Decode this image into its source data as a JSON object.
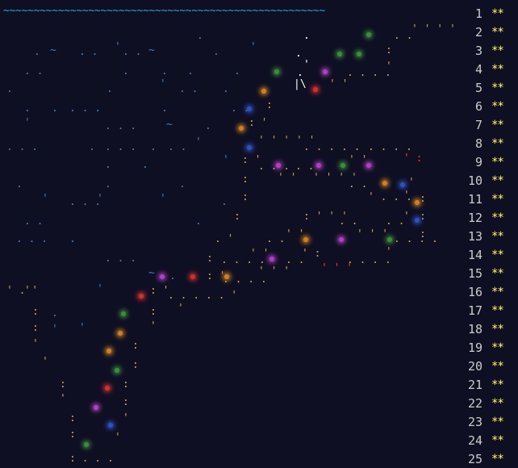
{
  "scene": {
    "wave_line": "~~~~~~~~~~~~~~~~~~~~~~~~~~~~~~~~~~~~~~~~~~~~~~~~~~~~~",
    "colors": {
      "background": "#0f0f23",
      "wave": "#2aa8d8",
      "path": "#c8a050",
      "red_mark": "#ff3030",
      "white": "#ffffff",
      "stars": "#ffff66",
      "numbers": "#cccccc"
    }
  },
  "calendar": {
    "days": [
      {
        "day": "1",
        "stars": "**"
      },
      {
        "day": "2",
        "stars": "**"
      },
      {
        "day": "3",
        "stars": "**"
      },
      {
        "day": "4",
        "stars": "**"
      },
      {
        "day": "5",
        "stars": "**"
      },
      {
        "day": "6",
        "stars": "**"
      },
      {
        "day": "7",
        "stars": "**"
      },
      {
        "day": "8",
        "stars": "**"
      },
      {
        "day": "9",
        "stars": "**"
      },
      {
        "day": "10",
        "stars": "**"
      },
      {
        "day": "11",
        "stars": "**"
      },
      {
        "day": "12",
        "stars": "**"
      },
      {
        "day": "13",
        "stars": "**"
      },
      {
        "day": "14",
        "stars": "**"
      },
      {
        "day": "15",
        "stars": "**"
      },
      {
        "day": "16",
        "stars": "**"
      },
      {
        "day": "17",
        "stars": "**"
      },
      {
        "day": "18",
        "stars": "**"
      },
      {
        "day": "19",
        "stars": "**"
      },
      {
        "day": "20",
        "stars": "**"
      },
      {
        "day": "21",
        "stars": "**"
      },
      {
        "day": "22",
        "stars": "**"
      },
      {
        "day": "23",
        "stars": "**"
      },
      {
        "day": "24",
        "stars": "**"
      },
      {
        "day": "25",
        "stars": "**"
      }
    ]
  }
}
